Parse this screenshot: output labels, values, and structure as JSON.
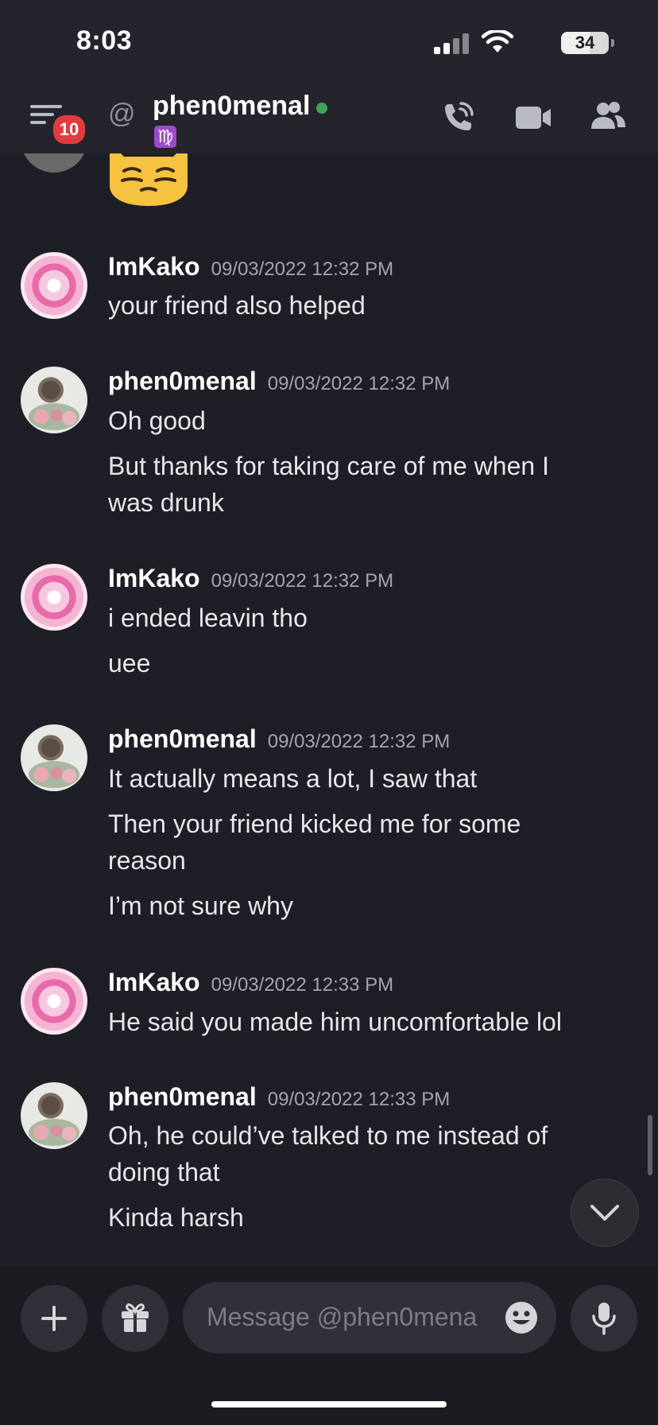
{
  "status_bar": {
    "time": "8:03",
    "battery": "34"
  },
  "header": {
    "menu_badge": "10",
    "at_symbol": "@",
    "title": "phen0menal",
    "status_emoji": "♍",
    "icons": [
      "call-icon",
      "video-icon",
      "members-icon"
    ]
  },
  "messages": [
    {
      "author": "ImKako",
      "timestamp": "09/03/2022 12:32 PM",
      "lines": [
        "your friend also helped"
      ]
    },
    {
      "author": "phen0menal",
      "timestamp": "09/03/2022 12:32 PM",
      "lines": [
        "Oh good",
        "But thanks for taking care of me when I",
        "was drunk"
      ]
    },
    {
      "author": "ImKako",
      "timestamp": "09/03/2022 12:32 PM",
      "lines": [
        "i ended leavin tho",
        "uee"
      ]
    },
    {
      "author": "phen0menal",
      "timestamp": "09/03/2022 12:32 PM",
      "lines": [
        "It actually means a lot, I saw that",
        "Then your friend kicked me for some",
        "reason",
        "I’m not sure why"
      ]
    },
    {
      "author": "ImKako",
      "timestamp": "09/03/2022 12:33 PM",
      "lines": [
        "He said you made him uncomfortable lol"
      ]
    },
    {
      "author": "phen0menal",
      "timestamp": "09/03/2022 12:33 PM",
      "lines": [
        "Oh, he could’ve talked to me instead of",
        "doing that",
        "Kinda harsh"
      ]
    }
  ],
  "composer": {
    "placeholder": "Message @phen0mena"
  },
  "colors": {
    "background": "#1e1f26",
    "header": "#25242c",
    "online": "#3ba55d",
    "badge": "#e23b3f"
  }
}
